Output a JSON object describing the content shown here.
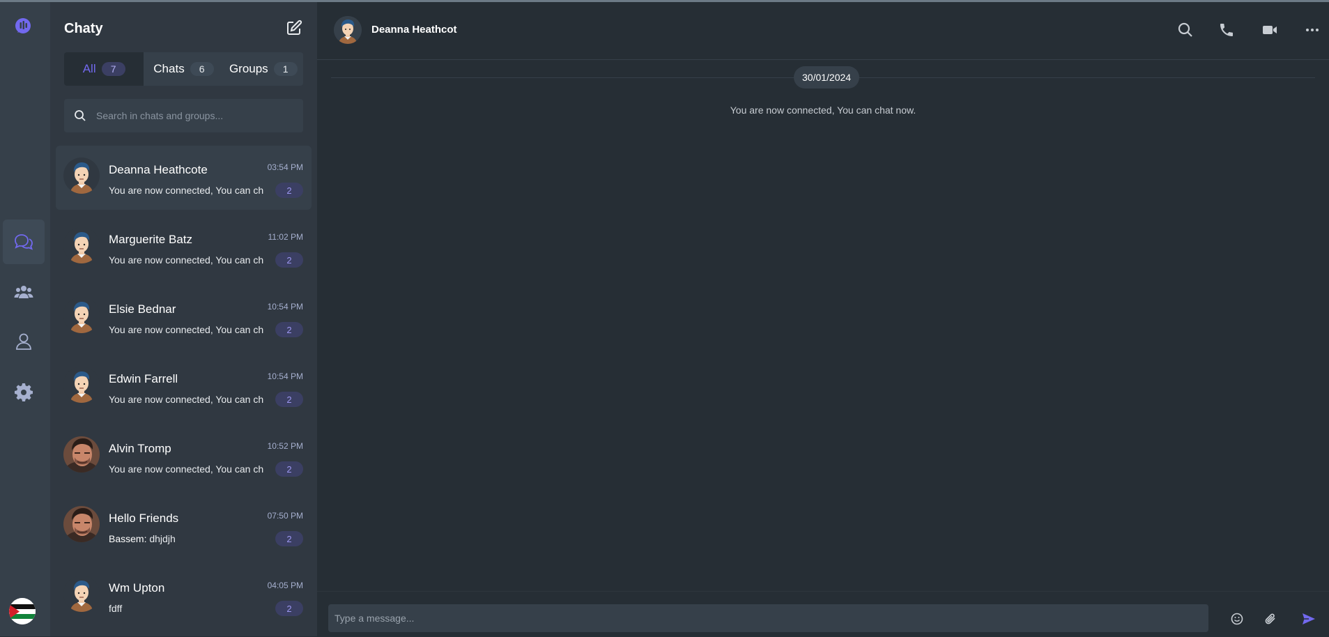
{
  "app": {
    "title": "Chaty"
  },
  "colors": {
    "accent": "#7269ef",
    "rail_bg": "#36404a",
    "panel_bg": "#303841",
    "conv_bg": "#262e35",
    "badge_bg": "#3b3f63"
  },
  "rail": {
    "items": [
      {
        "icon": "chat-bubbles-icon",
        "active": true
      },
      {
        "icon": "users-icon",
        "active": false
      },
      {
        "icon": "user-icon",
        "active": false
      },
      {
        "icon": "gear-icon",
        "active": false
      }
    ]
  },
  "tabs": [
    {
      "label": "All",
      "count": "7",
      "active": true
    },
    {
      "label": "Chats",
      "count": "6",
      "active": false
    },
    {
      "label": "Groups",
      "count": "1",
      "active": false
    }
  ],
  "search": {
    "placeholder": "Search in chats and groups..."
  },
  "chats": [
    {
      "name": "Deanna Heathcote",
      "time": "03:54 PM",
      "sender": "",
      "preview": "You are now connected, You can chat now.",
      "unread": "2",
      "avatar": "cartoon",
      "active": true
    },
    {
      "name": "Marguerite Batz",
      "time": "11:02 PM",
      "sender": "",
      "preview": "You are now connected, You can chat now.",
      "unread": "2",
      "avatar": "cartoon",
      "active": false
    },
    {
      "name": "Elsie Bednar",
      "time": "10:54 PM",
      "sender": "",
      "preview": "You are now connected, You can chat now.",
      "unread": "2",
      "avatar": "cartoon",
      "active": false
    },
    {
      "name": "Edwin Farrell",
      "time": "10:54 PM",
      "sender": "",
      "preview": "You are now connected, You can chat now.",
      "unread": "2",
      "avatar": "cartoon",
      "active": false
    },
    {
      "name": "Alvin Tromp",
      "time": "10:52 PM",
      "sender": "",
      "preview": "You are now connected, You can chat now.",
      "unread": "2",
      "avatar": "photo",
      "active": false
    },
    {
      "name": "Hello Friends",
      "time": "07:50 PM",
      "sender": "Bassem:",
      "preview": "dhjdjh",
      "unread": "2",
      "avatar": "photo",
      "active": false
    },
    {
      "name": "Wm Upton",
      "time": "04:05 PM",
      "sender": "",
      "preview": "fdff",
      "unread": "2",
      "avatar": "cartoon",
      "active": false
    }
  ],
  "conversation": {
    "title": "Deanna Heathcot",
    "date": "30/01/2024",
    "system_message": "You are now connected, You can chat now.",
    "input_placeholder": "Type a message..."
  }
}
